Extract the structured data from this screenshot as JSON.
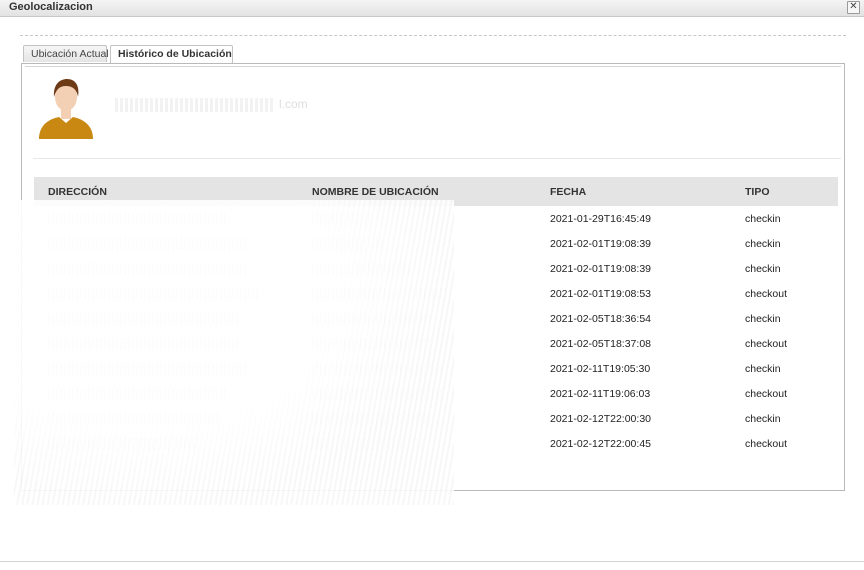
{
  "window": {
    "title": "Geolocalizacion",
    "close_glyph": "✕"
  },
  "tabs": [
    {
      "label": "Ubicación Actual",
      "active": false
    },
    {
      "label": "Histórico de Ubicación",
      "active": true
    }
  ],
  "profile": {
    "name_suffix": "l.com",
    "avatar_colors": {
      "skin": "#f3cfb3",
      "hair": "#6d3a16",
      "shirt": "#c98812"
    }
  },
  "table": {
    "headers": {
      "direccion": "DIRECCIÓN",
      "nombre": "NOMBRE DE UBICACIÓN",
      "fecha": "FECHA",
      "tipo": "TIPO"
    },
    "rows": [
      {
        "fecha": "2021-01-29T16:45:49",
        "tipo": "checkin"
      },
      {
        "fecha": "2021-02-01T19:08:39",
        "tipo": "checkin"
      },
      {
        "fecha": "2021-02-01T19:08:39",
        "tipo": "checkin"
      },
      {
        "fecha": "2021-02-01T19:08:53",
        "tipo": "checkout"
      },
      {
        "fecha": "2021-02-05T18:36:54",
        "tipo": "checkin"
      },
      {
        "fecha": "2021-02-05T18:37:08",
        "tipo": "checkout"
      },
      {
        "fecha": "2021-02-11T19:05:30",
        "tipo": "checkin"
      },
      {
        "fecha": "2021-02-11T19:06:03",
        "tipo": "checkout"
      },
      {
        "fecha": "2021-02-12T22:00:30",
        "tipo": "checkin"
      },
      {
        "fecha": "2021-02-12T22:00:45",
        "tipo": "checkout"
      }
    ]
  }
}
